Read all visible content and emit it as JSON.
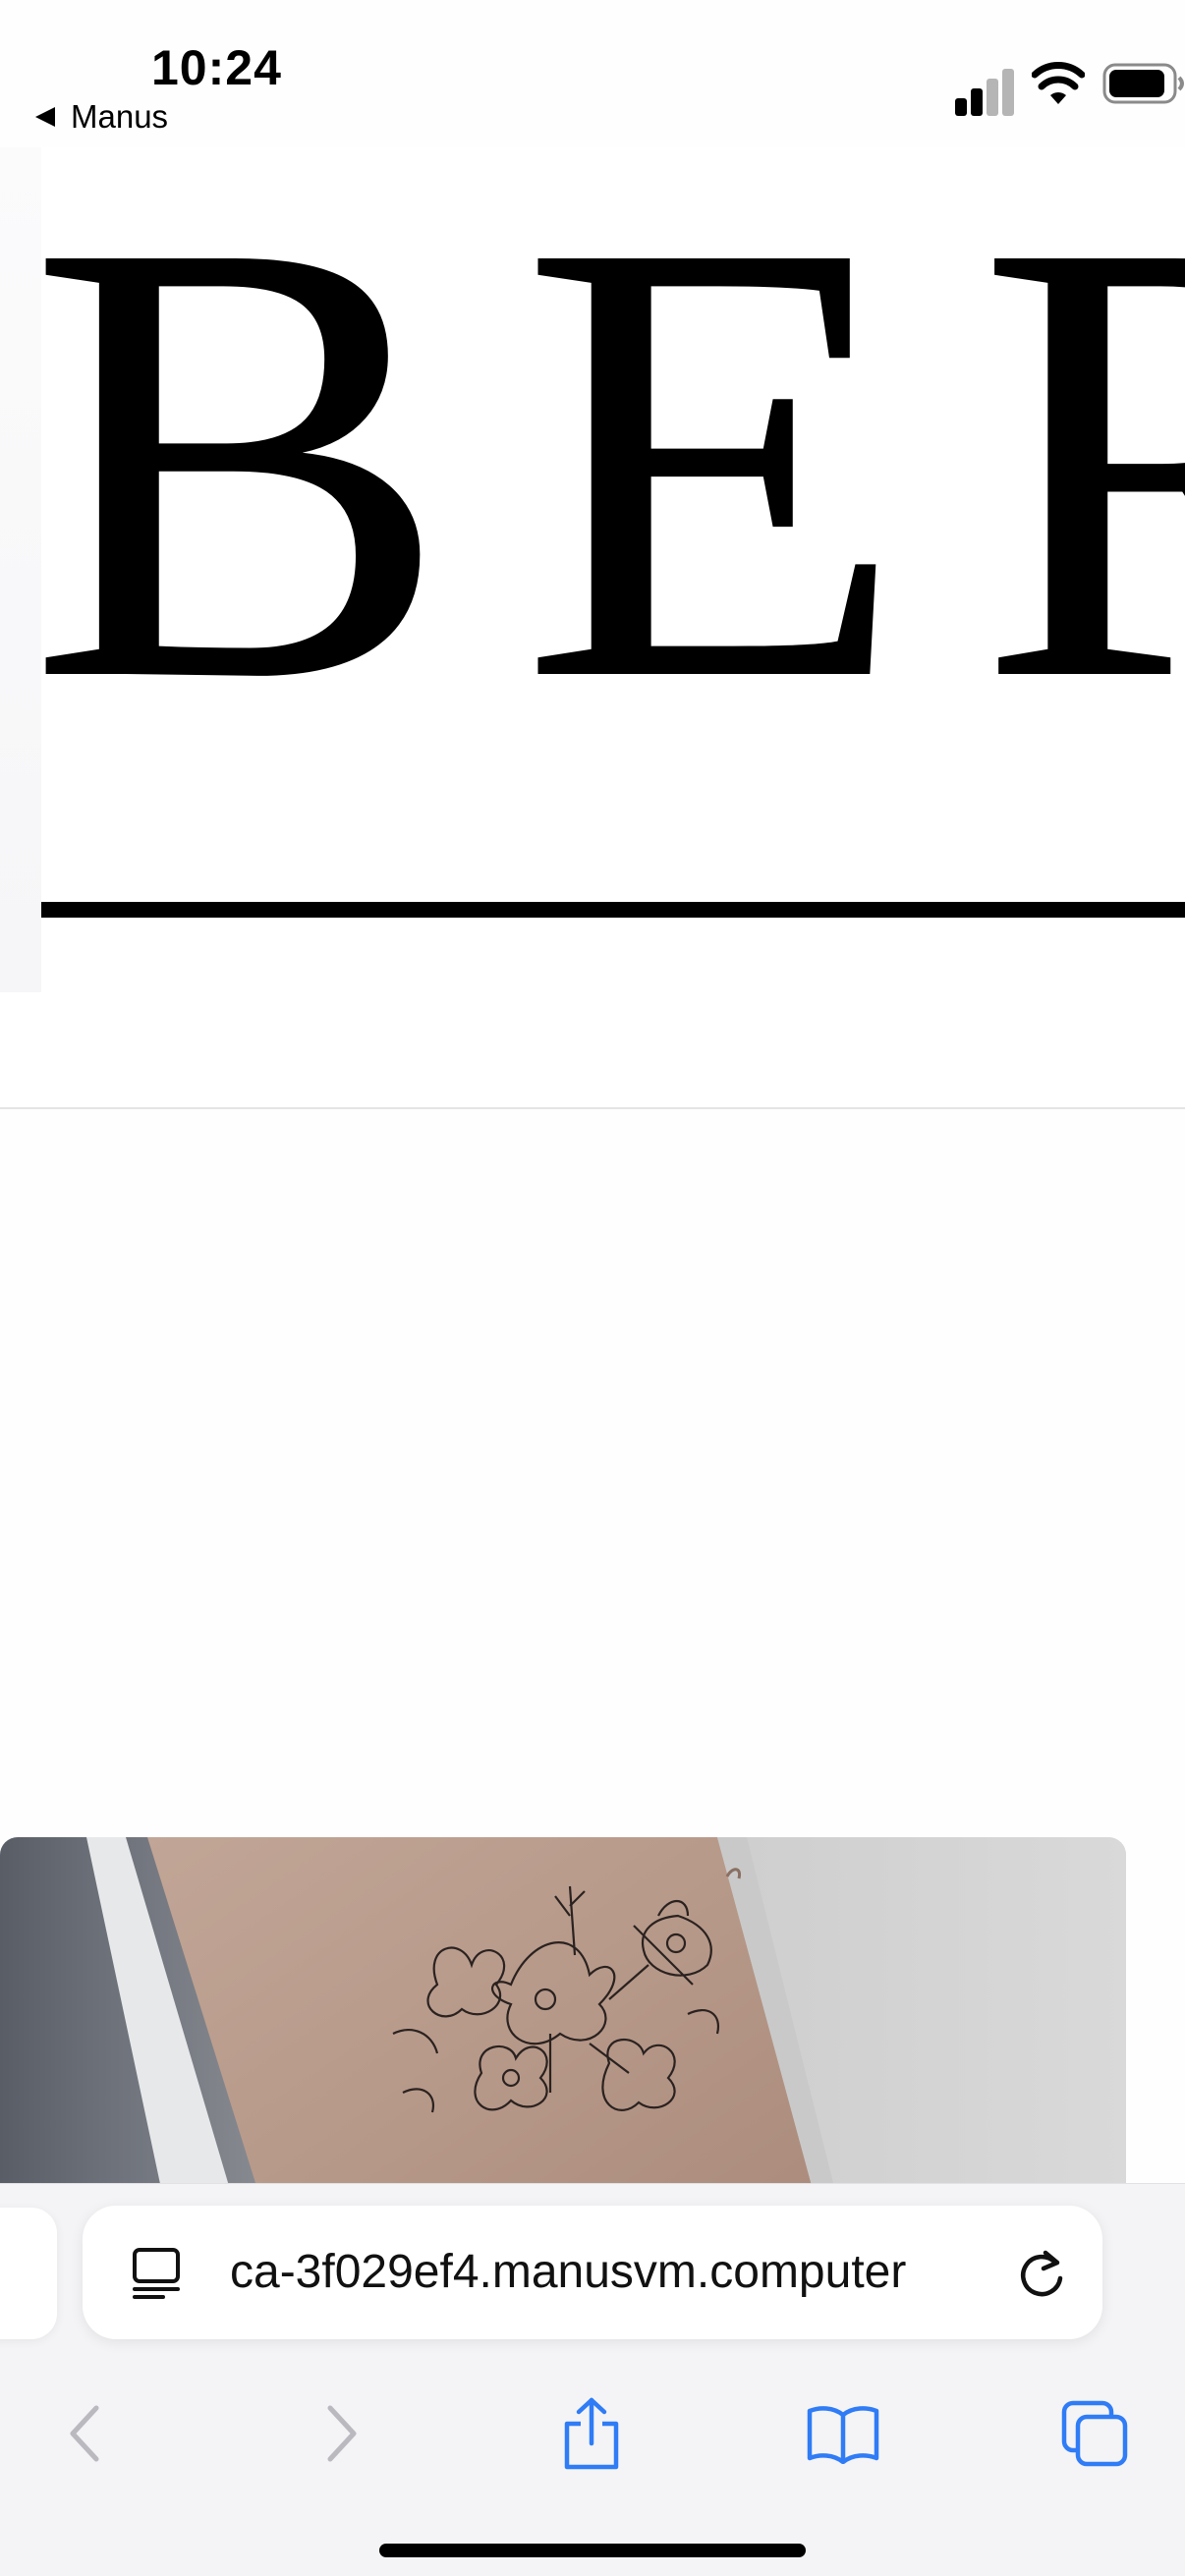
{
  "status_bar": {
    "time": "10:24",
    "back_app_label": "Manus",
    "icons": [
      "cellular-signal-icon",
      "wifi-icon",
      "battery-icon"
    ]
  },
  "page": {
    "logo_text": "BER",
    "image_alt": "fine-line floral tattoo on forearm"
  },
  "browser": {
    "url": "ca-3f029ef4.manusvm.computer",
    "toolbar": [
      "back-icon",
      "forward-icon",
      "share-icon",
      "bookmarks-icon",
      "tabs-icon"
    ],
    "accent_color": "#2f7cf6",
    "disabled_color": "#b9b9bf"
  }
}
